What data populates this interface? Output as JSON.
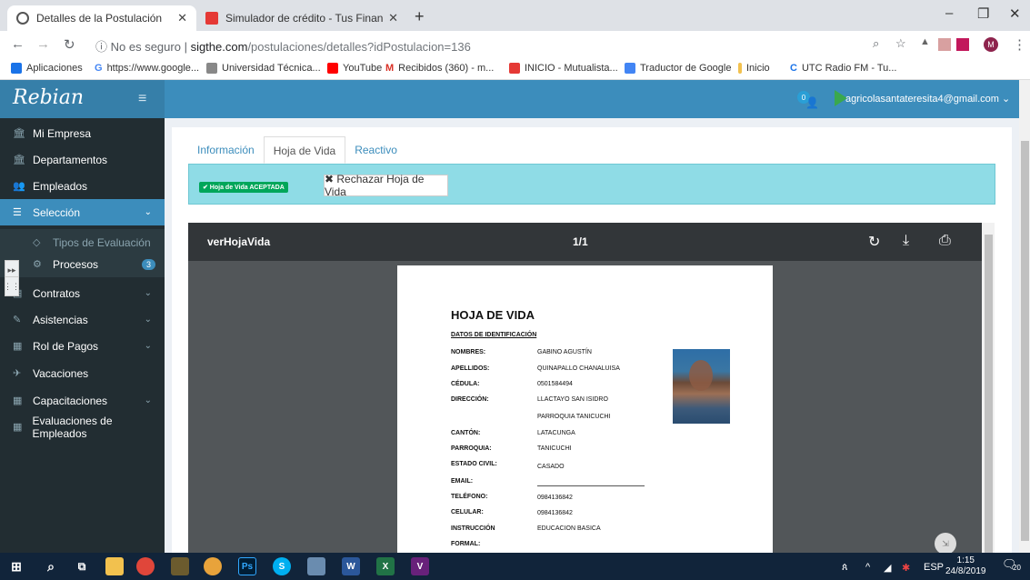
{
  "browser": {
    "tabs": [
      {
        "title": "Detalles de la Postulación",
        "active": true
      },
      {
        "title": "Simulador de crédito - Tus Finan",
        "active": false
      }
    ],
    "new_tab": "+",
    "controls": {
      "minimize": "–",
      "maximize": "❐",
      "close": "✕"
    },
    "address": {
      "security": "No es seguro",
      "domain": "sigthe.com",
      "path": "/postulaciones/detalles?idPostulacion=136"
    },
    "bookmarks": [
      "Aplicaciones",
      "https://www.google...",
      "Universidad Técnica...",
      "YouTube",
      "Recibidos (360) - m...",
      "INICIO - Mutualista...",
      "Traductor de Google",
      "Inicio",
      "UTC Radio FM - Tu..."
    ],
    "profile": "M"
  },
  "app": {
    "logo": "Rebian",
    "user_email": "agricolasantateresita4@gmail.com ⌄",
    "notif_count": "0",
    "sidebar": [
      {
        "label": "Mi Empresa",
        "icon": "bank-icon"
      },
      {
        "label": "Departamentos",
        "icon": "bank-icon"
      },
      {
        "label": "Empleados",
        "icon": "users-icon"
      },
      {
        "label": "Selección",
        "icon": "list-icon",
        "active": true
      },
      {
        "label": "Tipos de Evaluación",
        "icon": "tag-icon",
        "sub": true
      },
      {
        "label": "Procesos",
        "icon": "gear-icon",
        "sub": true,
        "badge": "3"
      },
      {
        "label": "Contratos",
        "icon": "doc-icon"
      },
      {
        "label": "Asistencias",
        "icon": "edit-icon"
      },
      {
        "label": "Rol de Pagos",
        "icon": "table-icon"
      },
      {
        "label": "Vacaciones",
        "icon": "plane-icon"
      },
      {
        "label": "Capacitaciones",
        "icon": "table-icon"
      },
      {
        "label": "Evaluaciones de Empleados",
        "icon": "table-icon"
      }
    ],
    "tabs": [
      "Información",
      "Hoja de Vida",
      "Reactivo"
    ],
    "status_badge": "✔ Hoja de Vida ACEPTADA",
    "reject_button": "✖ Rechazar Hoja de Vida",
    "pdf": {
      "title": "verHojaVida",
      "page": "1/1"
    },
    "doc": {
      "heading": "HOJA DE VIDA",
      "section": "DATOS DE IDENTIFICACIÓN",
      "fields": [
        {
          "k": "NOMBRES:",
          "v": "GABINO AGUSTÍN"
        },
        {
          "k": "APELLIDOS:",
          "v": "QUINAPALLO CHANALUISA"
        },
        {
          "k": "CÉDULA:",
          "v": "0501584494"
        },
        {
          "k": "DIRECCIÓN:",
          "v": "LLACTAYO SAN ISIDRO"
        },
        {
          "k": "",
          "v": "PARROQUIA TANICUCHI"
        },
        {
          "k": "CANTÓN:",
          "v": "LATACUNGA"
        },
        {
          "k": "PARROQUIA:",
          "v": "TANICUCHI"
        },
        {
          "k": "ESTADO CIVIL:",
          "v": "CASADO"
        },
        {
          "k": "EMAIL:",
          "v": ""
        },
        {
          "k": "TELÉFONO:",
          "v": "0984136842"
        },
        {
          "k": "CELULAR:",
          "v": "0984136842"
        },
        {
          "k": "INSTRUCCIÓN",
          "v": "EDUCACION BASICA"
        },
        {
          "k": "FORMAL:",
          "v": ""
        }
      ]
    }
  },
  "taskbar": {
    "lang": "ESP",
    "time": "1:15",
    "date": "24/8/2019",
    "notif": "20"
  },
  "colors": {
    "sidebar": "#222d32",
    "topbar": "#3c8dbc",
    "alert": "#8fdce6",
    "success": "#00a65a"
  }
}
